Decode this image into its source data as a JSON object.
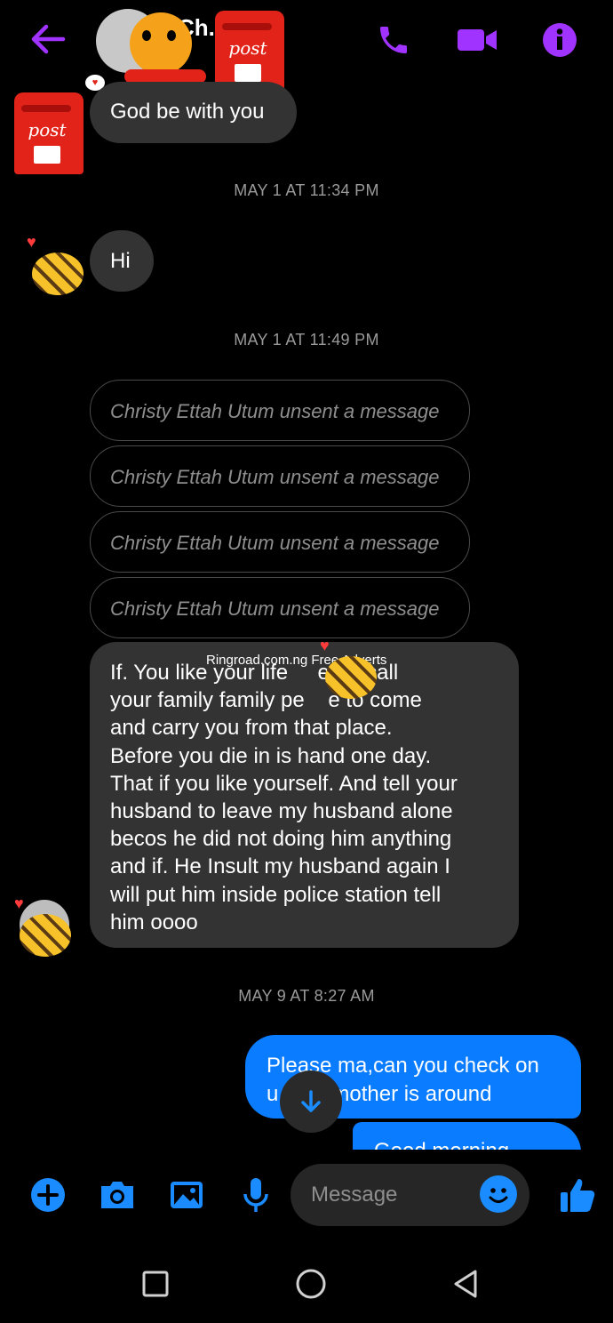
{
  "header": {
    "contact_name": "Ch... U...",
    "colors": {
      "accent": "#a033ff"
    }
  },
  "messages": {
    "incoming_top": "God be with you",
    "ts1": "MAY 1 AT 11:34 PM",
    "hi": "Hi",
    "ts2": "MAY 1 AT 11:49 PM",
    "unsent": [
      "Christy Ettah Utum unsent a message",
      "Christy Ettah Utum unsent a message",
      "Christy Ettah Utum unsent a message",
      "Christy Ettah Utum unsent a message"
    ],
    "long_lines": [
      "If. You like your life     etter call",
      "your family family pe    e to come",
      "and carry you from that place.",
      "Before you die in is hand one day.",
      "That if you like yourself. And tell your",
      "husband to leave my husband alone",
      "becos he did not doing him anything",
      "and if. He Insult my husband again I",
      "will put him inside police station tell",
      "him oooo"
    ],
    "ts3": "MAY 9 AT 8:27 AM",
    "outgoing_lines": [
      "Please ma,can you check on",
      "u         mother is around"
    ],
    "outgoing_partial": "Good morning"
  },
  "watermark": "Ringroad.com.ng Free Adverts",
  "sticker_text": "post",
  "composer": {
    "placeholder": "Message",
    "colors": {
      "icon": "#1a8cff"
    }
  }
}
